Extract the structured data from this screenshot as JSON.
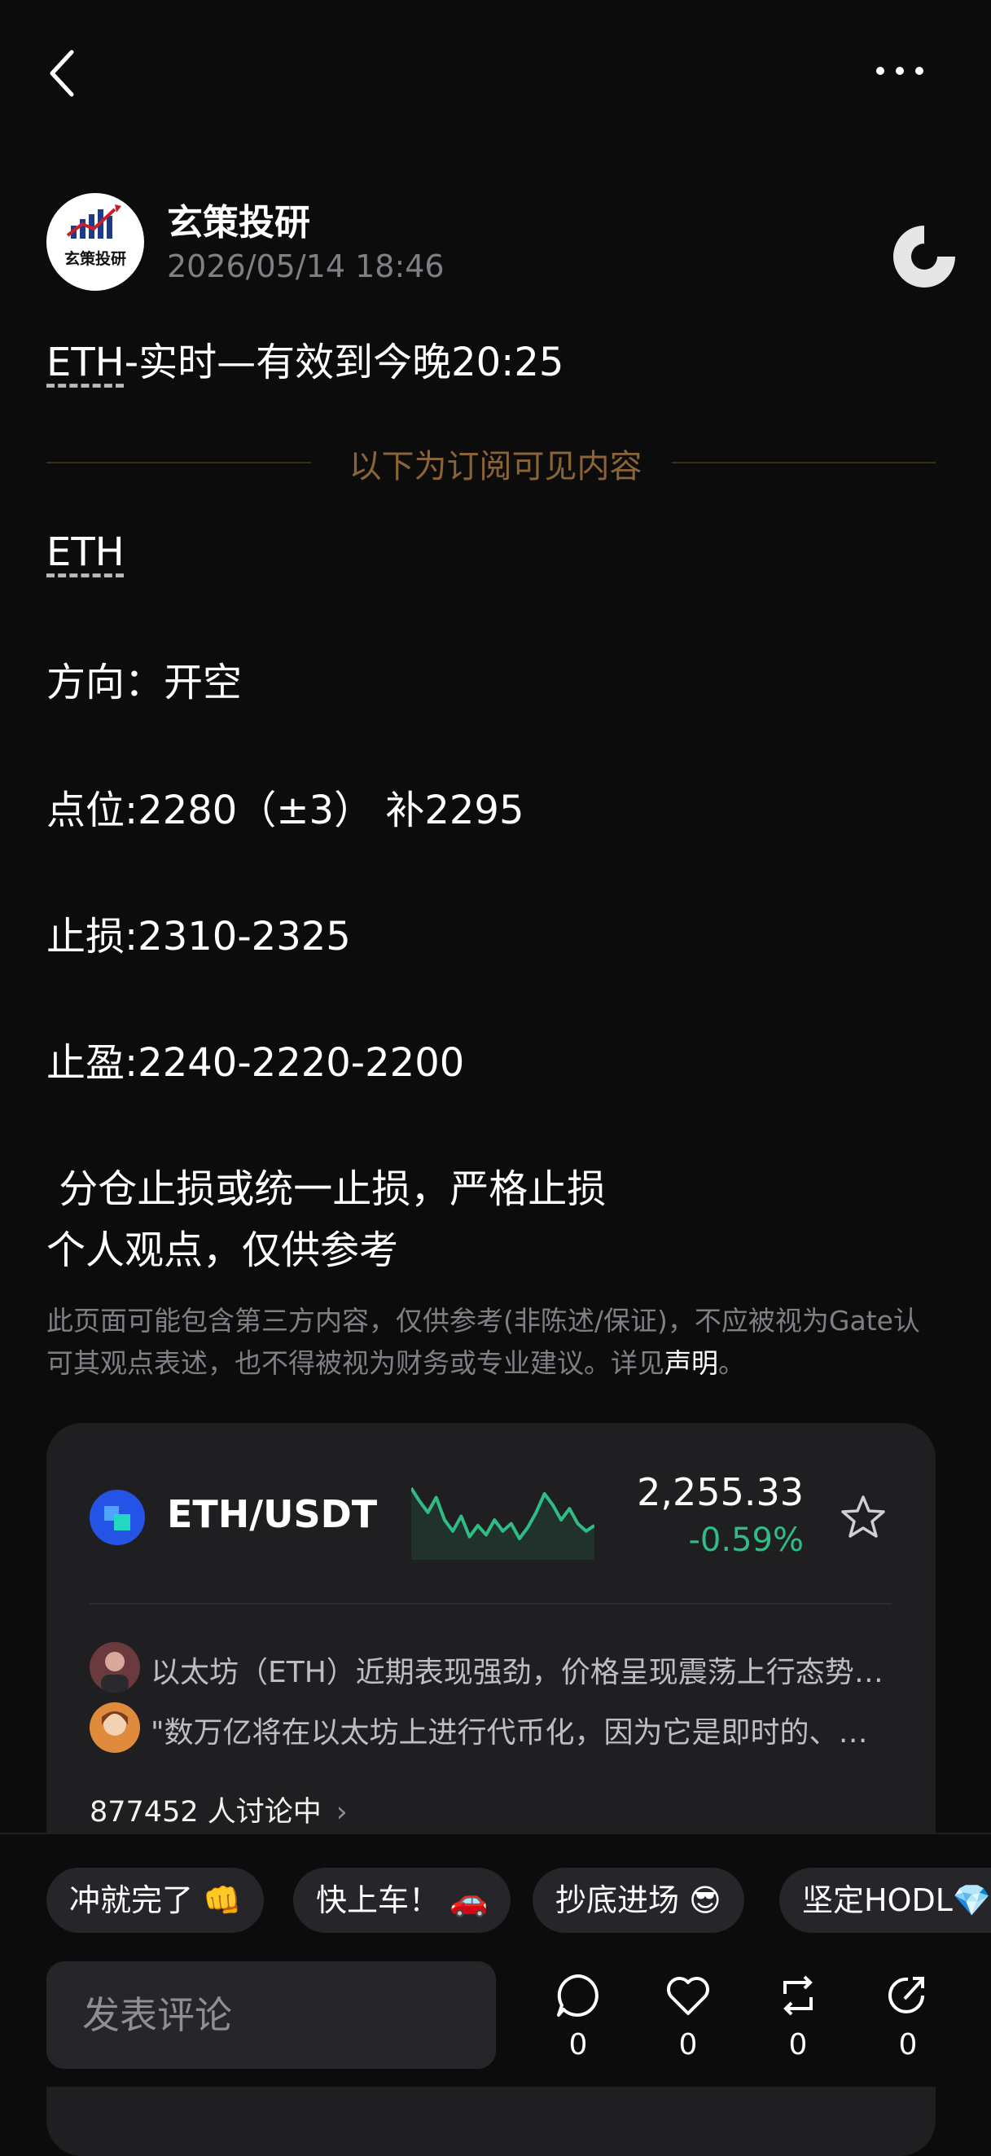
{
  "author": {
    "name": "玄策投研",
    "avatar_text": "玄策投研",
    "time": "2026/05/14 18:46"
  },
  "post": {
    "title_symbol": "ETH",
    "title_rest": "-实时—有效到今晚20:25"
  },
  "subscriber_divider": "以下为订阅可见内容",
  "content": {
    "symbol": "ETH",
    "direction": "方向：开空",
    "entry": "点位:2280（±3） 补2295",
    "stop_loss": "止损:2310-2325",
    "take_profit": "止盈:2240-2220-2200",
    "note1": " 分仓止损或统一止损，严格止损",
    "note2": "个人观点，仅供参考"
  },
  "disclaimer": {
    "text": "此页面可能包含第三方内容，仅供参考(非陈述/保证)，不应被视为Gate认可其观点表述，也不得被视为财务或专业建议。详见",
    "link": "声明",
    "end": "。"
  },
  "ticker": {
    "pair": "ETH/USDT",
    "price": "2,255.33",
    "change": "-0.59%",
    "change_color": "#2ebd85",
    "sparkline": [
      2275,
      2268,
      2262,
      2270,
      2258,
      2252,
      2260,
      2249,
      2255,
      2250,
      2258,
      2252,
      2256,
      2248,
      2254,
      2262,
      2272,
      2266,
      2258,
      2264,
      2256,
      2252,
      2255
    ]
  },
  "discussions": [
    {
      "text": "以太坊（ETH）近期表现强劲，价格呈现震荡上行态势，市场情绪偏向乐观"
    },
    {
      "text": "\"数万亿将在以太坊上进行代币化，因为它是即时的、透明的\""
    }
  ],
  "discussing": "877452 人讨论中",
  "chips": [
    "冲就完了 👊",
    "快上车！ 🚗",
    "抄底进场 😎",
    "坚定HODL💎"
  ],
  "comment_placeholder": "发表评论",
  "actions": {
    "comments": "0",
    "likes": "0",
    "reposts": "0",
    "shares": "0"
  }
}
